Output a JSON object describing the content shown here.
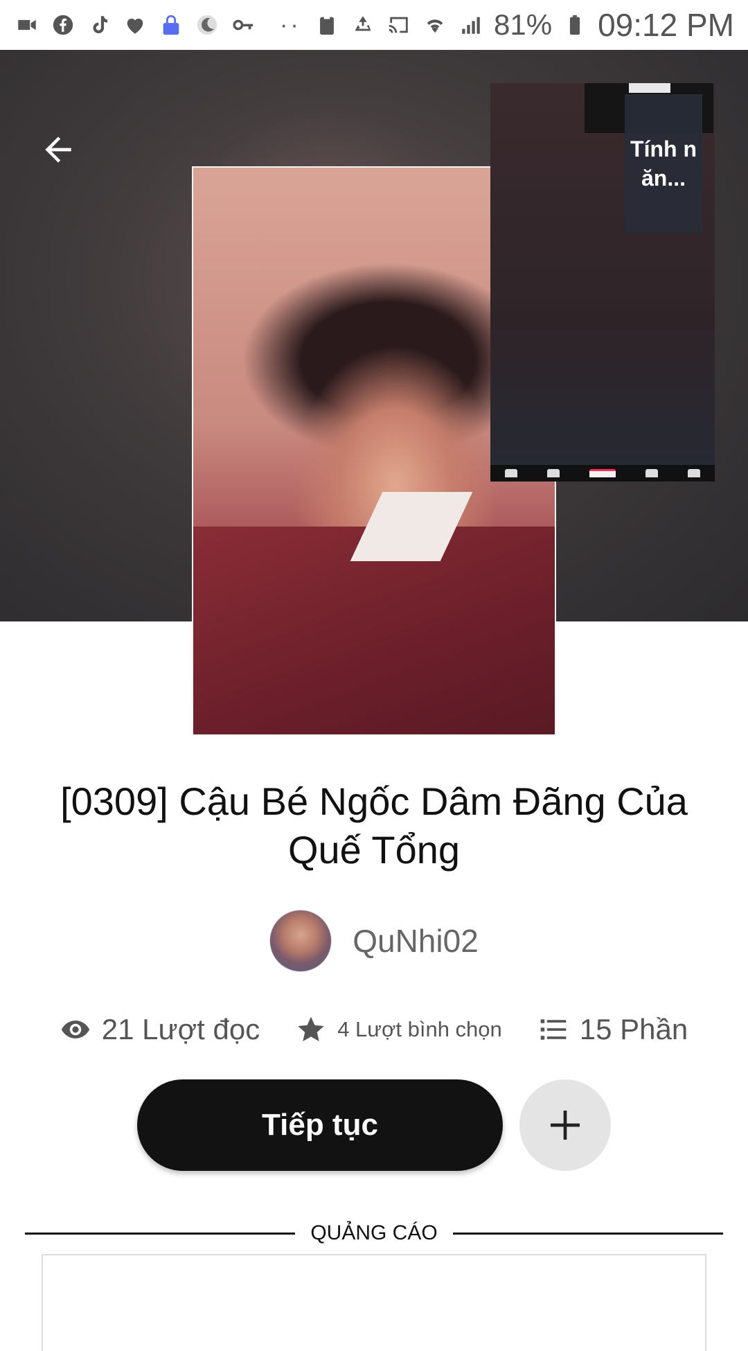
{
  "status_bar": {
    "battery": "81%",
    "time": "09:12 PM",
    "left_icons": [
      "video-icon",
      "facebook-icon",
      "tiktok-icon",
      "heart-icon",
      "lock-icon",
      "moon-icon",
      "key-icon"
    ],
    "right_icons": [
      "clipboard-icon",
      "recycle-icon",
      "cast-icon",
      "wifi-icon",
      "signal-icon",
      "battery-icon"
    ]
  },
  "overlay": {
    "badge_text": "Tính năn..."
  },
  "story": {
    "title": "[0309] Cậu Bé Ngốc Dâm Đãng Của Quế Tổng",
    "author": "QuNhi02",
    "reads": "21 Lượt đọc",
    "votes": "4 Lượt bình chọn",
    "parts": "15 Phần"
  },
  "actions": {
    "continue_label": "Tiếp tục"
  },
  "ad": {
    "label": "QUẢNG CÁO"
  },
  "colors": {
    "primary_button": "#121212",
    "secondary_button": "#e4e4e4",
    "text_primary": "#111111",
    "text_secondary": "#555555"
  }
}
